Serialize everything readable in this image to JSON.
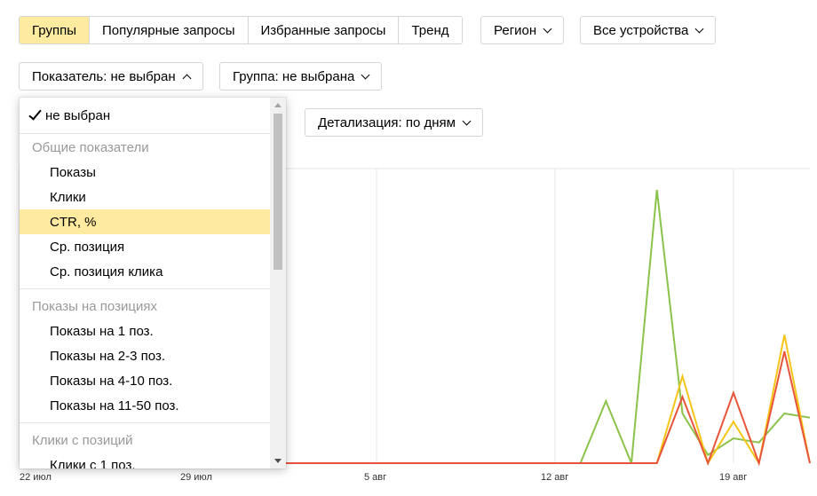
{
  "tabs": [
    {
      "label": "Группы",
      "active": true
    },
    {
      "label": "Популярные запросы",
      "active": false
    },
    {
      "label": "Избранные запросы",
      "active": false
    },
    {
      "label": "Тренд",
      "active": false
    }
  ],
  "filters": {
    "region": "Регион",
    "devices": "Все устройства",
    "indicator": "Показатель: не выбран",
    "group": "Группа: не выбрана",
    "detail": "Детализация: по дням"
  },
  "dropdown": {
    "selected": "не выбран",
    "sections": [
      {
        "title": "Общие показатели",
        "items": [
          "Показы",
          "Клики",
          "CTR, %",
          "Ср. позиция",
          "Ср. позиция клика"
        ]
      },
      {
        "title": "Показы на позициях",
        "items": [
          "Показы на 1 поз.",
          "Показы на 2-3 поз.",
          "Показы на 4-10 поз.",
          "Показы на 11-50 поз."
        ]
      },
      {
        "title": "Клики с позиций",
        "items": [
          "Клики с 1 поз."
        ]
      }
    ],
    "highlighted": "CTR, %"
  },
  "chart_data": {
    "type": "line",
    "x_ticks": [
      "22 июл",
      "29 июл",
      "5 авг",
      "12 авг",
      "19 авг"
    ],
    "grid": true,
    "series": [
      {
        "color": "#8bc34a",
        "values": [
          0,
          0,
          0,
          0,
          0,
          0,
          0,
          0,
          0,
          0,
          0,
          0,
          0,
          0,
          0,
          0,
          0,
          0,
          0,
          0,
          0,
          0,
          0,
          1.5,
          0,
          6.6,
          1.2,
          0.2,
          0.6,
          0.5,
          1.2,
          1.1
        ]
      },
      {
        "color": "#f5c518",
        "values": [
          0,
          0,
          0,
          0,
          0,
          0,
          0,
          0,
          0,
          0,
          0,
          0,
          0,
          0,
          0,
          0,
          0,
          0,
          0,
          0,
          0,
          0,
          0,
          0,
          0,
          0,
          2.1,
          0,
          1.0,
          0,
          3.1,
          0
        ]
      },
      {
        "color": "#e8543a",
        "values": [
          0,
          0,
          0,
          0,
          0,
          0,
          0,
          0,
          0,
          0,
          0,
          0,
          0,
          0,
          0,
          0,
          0,
          0,
          0,
          0,
          0,
          0,
          0,
          0,
          0,
          0,
          1.6,
          0,
          1.7,
          0,
          2.7,
          0
        ]
      }
    ]
  }
}
